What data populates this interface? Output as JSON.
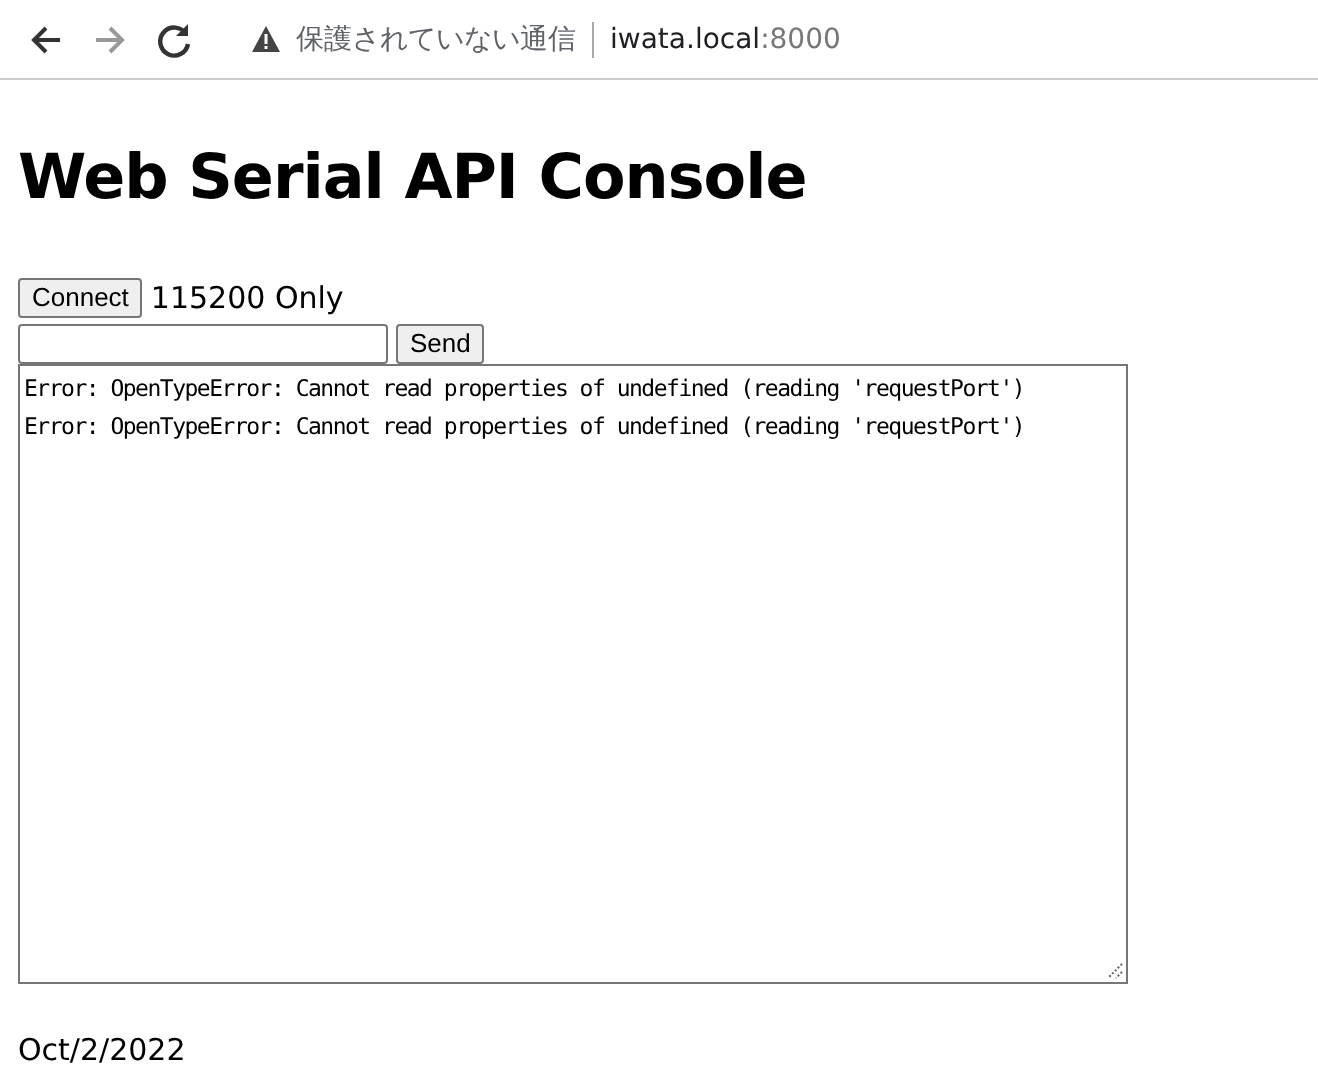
{
  "browser": {
    "security_label": "保護されていない通信",
    "host": "iwata.local",
    "port": ":8000"
  },
  "page": {
    "title": "Web Serial API Console",
    "connect_button": "Connect",
    "baud_note": "115200 Only",
    "send_button": "Send",
    "console_lines": [
      "Error: OpenTypeError: Cannot read properties of undefined (reading 'requestPort')",
      "Error: OpenTypeError: Cannot read properties of undefined (reading 'requestPort')"
    ],
    "date": "Oct/2/2022"
  }
}
